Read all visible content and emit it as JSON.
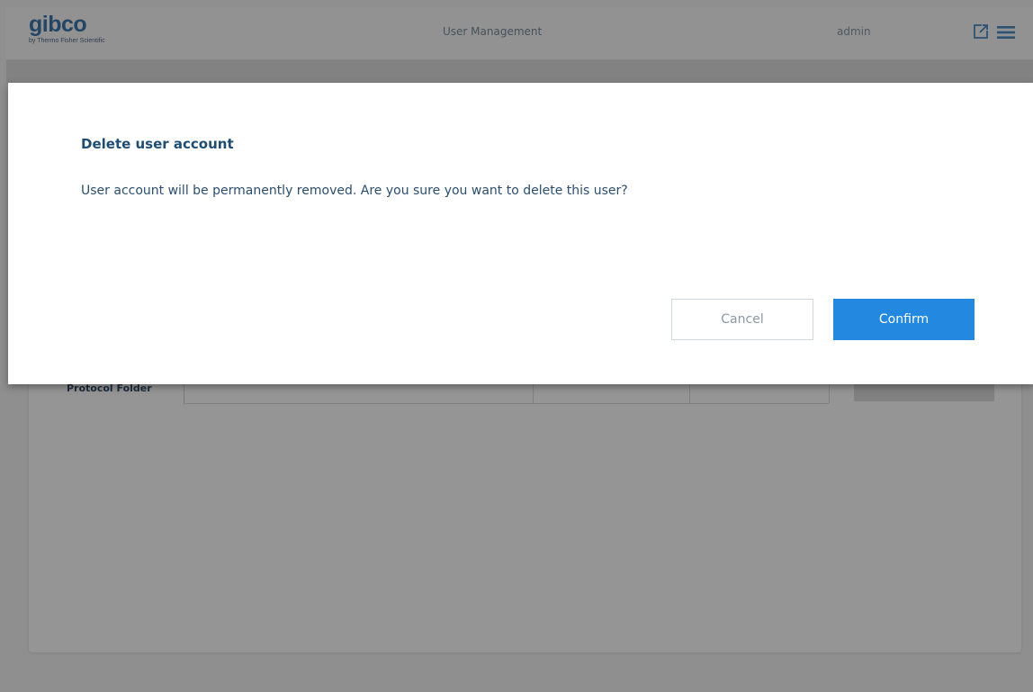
{
  "app": {
    "logo_text": "gibco",
    "logo_subtext": "by Thermo Fisher Scientific",
    "title": "User Management",
    "user": "admin",
    "icons": [
      "export-icon",
      "menu-icon"
    ]
  },
  "background": {
    "field_label": "Protocol Folder"
  },
  "dialog": {
    "title": "Delete user account",
    "message": "User account will be permanently removed. Are you sure you want to delete this user?",
    "cancel_label": "Cancel",
    "confirm_label": "Confirm"
  },
  "colors": {
    "brand": "#2b6aa3",
    "primary_button": "#2288e0",
    "title_text": "#1e4d74"
  }
}
